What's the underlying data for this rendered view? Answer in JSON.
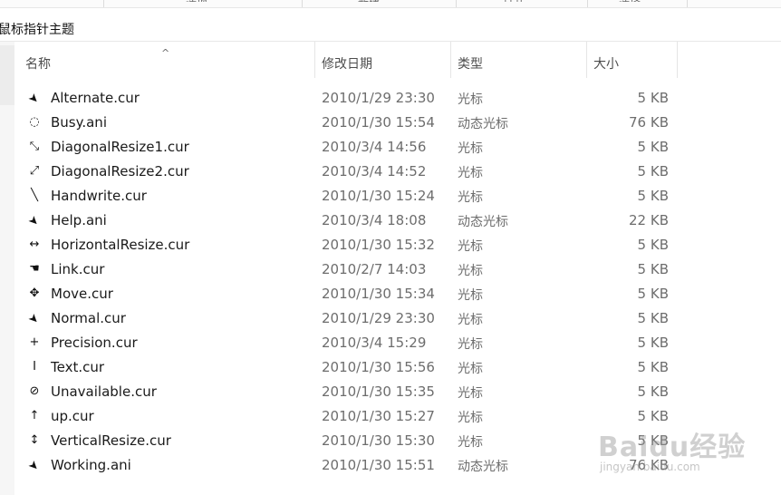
{
  "ribbon": {
    "labels": [
      "选项",
      "新建",
      "打开",
      "选择"
    ]
  },
  "address": {
    "path": "鼠标指针主题"
  },
  "columns": {
    "name": "名称",
    "date": "修改日期",
    "type": "类型",
    "size": "大小"
  },
  "files": [
    {
      "icon": "arrow-pointer-icon",
      "glyph": "➤",
      "name": "Alternate.cur",
      "date": "2010/1/29 23:30",
      "type": "光标",
      "size": "5 KB"
    },
    {
      "icon": "busy-ring-icon",
      "glyph": "◌",
      "name": "Busy.ani",
      "date": "2010/1/30 15:54",
      "type": "动态光标",
      "size": "76 KB"
    },
    {
      "icon": "diagonal-resize-icon",
      "glyph": "⤡",
      "name": "DiagonalResize1.cur",
      "date": "2010/3/4 14:56",
      "type": "光标",
      "size": "5 KB"
    },
    {
      "icon": "diagonal-resize-icon",
      "glyph": "⤢",
      "name": "DiagonalResize2.cur",
      "date": "2010/3/4 14:52",
      "type": "光标",
      "size": "5 KB"
    },
    {
      "icon": "pen-icon",
      "glyph": "╲",
      "name": "Handwrite.cur",
      "date": "2010/1/30 15:24",
      "type": "光标",
      "size": "5 KB"
    },
    {
      "icon": "help-pointer-icon",
      "glyph": "➤",
      "name": "Help.ani",
      "date": "2010/3/4 18:08",
      "type": "动态光标",
      "size": "22 KB"
    },
    {
      "icon": "horizontal-resize-icon",
      "glyph": "↔",
      "name": "HorizontalResize.cur",
      "date": "2010/1/30 15:32",
      "type": "光标",
      "size": "5 KB"
    },
    {
      "icon": "hand-link-icon",
      "glyph": "☚",
      "name": "Link.cur",
      "date": "2010/2/7 14:03",
      "type": "光标",
      "size": "5 KB"
    },
    {
      "icon": "move-icon",
      "glyph": "✥",
      "name": "Move.cur",
      "date": "2010/1/30 15:34",
      "type": "光标",
      "size": "5 KB"
    },
    {
      "icon": "arrow-pointer-icon",
      "glyph": "➤",
      "name": "Normal.cur",
      "date": "2010/1/29 23:30",
      "type": "光标",
      "size": "5 KB"
    },
    {
      "icon": "precision-cross-icon",
      "glyph": "+",
      "name": "Precision.cur",
      "date": "2010/3/4 15:29",
      "type": "光标",
      "size": "5 KB"
    },
    {
      "icon": "text-beam-icon",
      "glyph": "I",
      "name": "Text.cur",
      "date": "2010/1/30 15:56",
      "type": "光标",
      "size": "5 KB"
    },
    {
      "icon": "unavailable-icon",
      "glyph": "⊘",
      "name": "Unavailable.cur",
      "date": "2010/1/30 15:35",
      "type": "光标",
      "size": "5 KB"
    },
    {
      "icon": "up-arrow-icon",
      "glyph": "↑",
      "name": "up.cur",
      "date": "2010/1/30 15:27",
      "type": "光标",
      "size": "5 KB"
    },
    {
      "icon": "vertical-resize-icon",
      "glyph": "↕",
      "name": "VerticalResize.cur",
      "date": "2010/1/30 15:30",
      "type": "光标",
      "size": "5 KB"
    },
    {
      "icon": "working-pointer-icon",
      "glyph": "➤",
      "name": "Working.ani",
      "date": "2010/1/30 15:51",
      "type": "动态光标",
      "size": "76 KB"
    }
  ],
  "watermark": {
    "brand": "Baidu经验",
    "url": "jingyan.baidu.com"
  }
}
